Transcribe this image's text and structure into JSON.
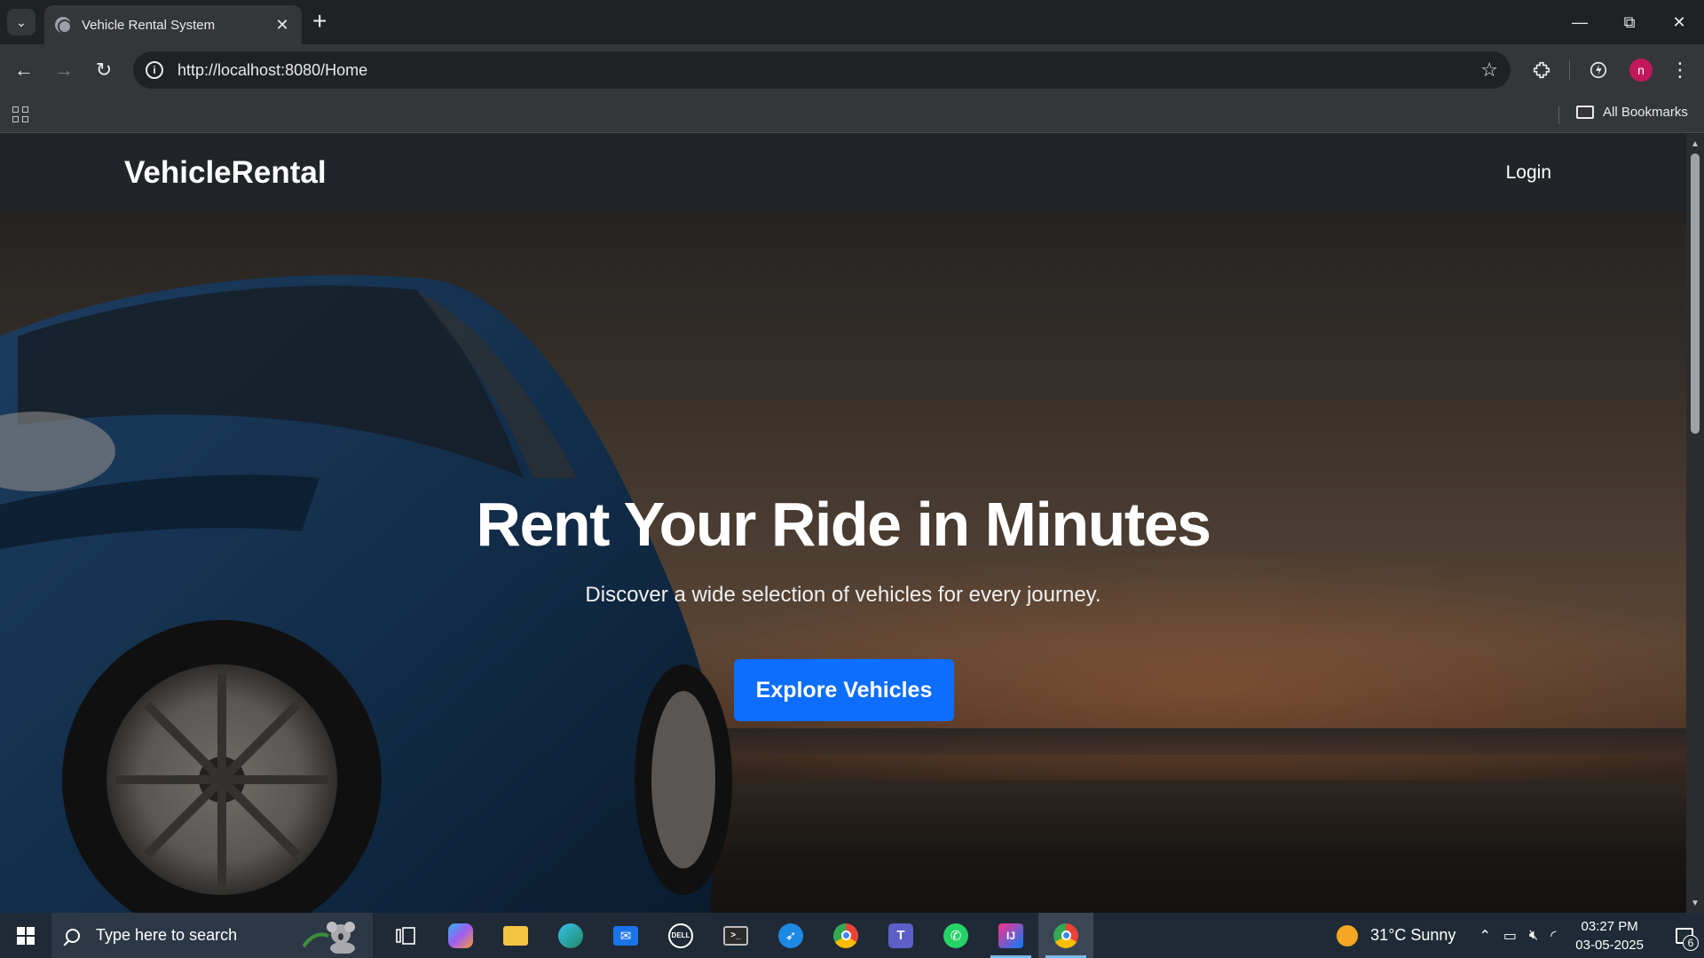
{
  "browser": {
    "tab_title": "Vehicle Rental System",
    "url": "http://localhost:8080/Home",
    "bookmarks_label": "All Bookmarks",
    "profile_initial": "n"
  },
  "page": {
    "brand": "VehicleRental",
    "nav_login": "Login",
    "hero_title": "Rent Your Ride in Minutes",
    "hero_subtitle": "Discover a wide selection of vehicles for every journey.",
    "hero_button": "Explore Vehicles"
  },
  "taskbar": {
    "search_placeholder": "Type here to search",
    "weather": "31°C  Sunny",
    "time": "03:27 PM",
    "date": "03-05-2025",
    "notification_count": "6",
    "apps": [
      "task-view",
      "copilot",
      "file-explorer",
      "edge",
      "mail",
      "dell",
      "terminal",
      "safari-like",
      "chrome",
      "teams",
      "whatsapp",
      "intellij",
      "chrome-profile"
    ]
  },
  "colors": {
    "navbar_bg": "#212529",
    "primary_button": "#0d6efd",
    "browser_bg": "#202124",
    "taskbar_bg": "#1f2a36"
  }
}
